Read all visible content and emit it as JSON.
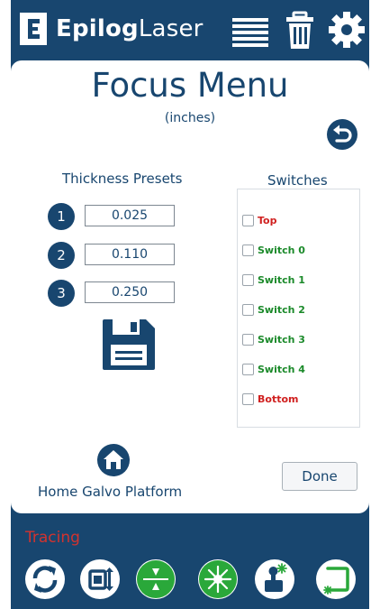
{
  "header": {
    "brand_bold": "Epilog",
    "brand_light": "Laser",
    "icons": [
      "list-icon",
      "trash-icon",
      "gear-icon"
    ]
  },
  "page": {
    "title": "Focus Menu",
    "subtitle": "(inches)"
  },
  "presets": {
    "label": "Thickness Presets",
    "items": [
      {
        "number": "1",
        "value": "0.025"
      },
      {
        "number": "2",
        "value": "0.110"
      },
      {
        "number": "3",
        "value": "0.250"
      }
    ]
  },
  "switches": {
    "label": "Switches",
    "items": [
      {
        "label": "Top",
        "color": "#d0201f"
      },
      {
        "label": "Switch 0",
        "color": "#1b8a2a"
      },
      {
        "label": "Switch 1",
        "color": "#1b8a2a"
      },
      {
        "label": "Switch 2",
        "color": "#1b8a2a"
      },
      {
        "label": "Switch 3",
        "color": "#1b8a2a"
      },
      {
        "label": "Switch 4",
        "color": "#1b8a2a"
      },
      {
        "label": "Bottom",
        "color": "#d0201f"
      }
    ]
  },
  "home": {
    "label": "Home Galvo Platform"
  },
  "done": {
    "label": "Done"
  },
  "status": {
    "text": "Tracing"
  },
  "toolbar": {
    "icons": [
      "refresh-icon",
      "frame-icon",
      "focus-icon",
      "laser-icon",
      "joystick-icon",
      "corner-icon"
    ]
  },
  "colors": {
    "primary": "#18466f",
    "accent_green": "#1b8a2a",
    "accent_red": "#d0201f",
    "status_red": "#d2332f"
  }
}
